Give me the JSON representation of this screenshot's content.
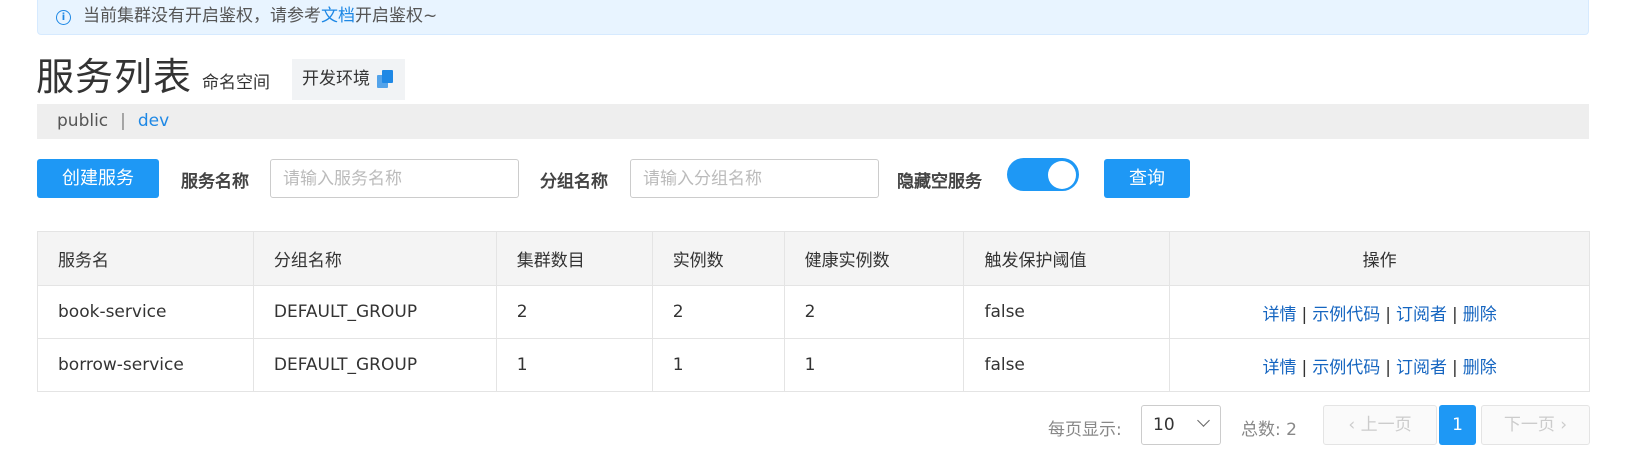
{
  "notice": {
    "before_link": "当前集群没有开启鉴权，请参考",
    "link": "文档",
    "after_link": "开启鉴权~"
  },
  "header": {
    "title": "服务列表",
    "namespace_label": "命名空间",
    "env_tag": "开发环境"
  },
  "namespaces": [
    "public",
    "dev"
  ],
  "active_namespace": "dev",
  "filters": {
    "create_label": "创建服务",
    "service_name_label": "服务名称",
    "service_name_placeholder": "请输入服务名称",
    "group_name_label": "分组名称",
    "group_name_placeholder": "请输入分组名称",
    "hide_empty_label": "隐藏空服务",
    "hide_empty_on": true,
    "query_label": "查询"
  },
  "table": {
    "columns": [
      "服务名",
      "分组名称",
      "集群数目",
      "实例数",
      "健康实例数",
      "触发保护阈值",
      "操作"
    ],
    "rows": [
      [
        "book-service",
        "DEFAULT_GROUP",
        "2",
        "2",
        "2",
        "false"
      ],
      [
        "borrow-service",
        "DEFAULT_GROUP",
        "1",
        "1",
        "1",
        "false"
      ]
    ],
    "actions": [
      "详情",
      "示例代码",
      "订阅者",
      "删除"
    ]
  },
  "pagination": {
    "page_size_label": "每页显示:",
    "page_size": "10",
    "total_label": "总数:",
    "total": "2",
    "prev_label": "上一页",
    "current_page": "1",
    "next_label": "下一页"
  },
  "colors": {
    "primary": "#1e98f5",
    "link": "#1565c0",
    "notice_bg": "#e8f4ff"
  }
}
